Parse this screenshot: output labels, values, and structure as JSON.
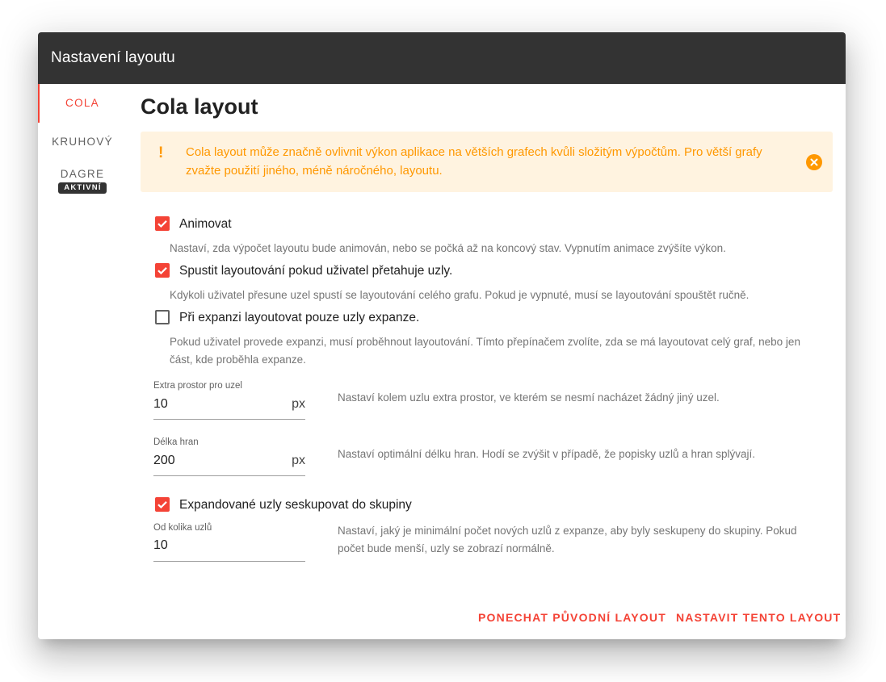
{
  "dialog": {
    "title": "Nastavení layoutu"
  },
  "tabs": [
    {
      "label": "COLA",
      "active": true
    },
    {
      "label": "KRUHOVÝ",
      "active": false
    },
    {
      "label": "DAGRE",
      "active": false,
      "badge": "AKTIVNÍ"
    }
  ],
  "content": {
    "heading": "Cola layout",
    "alert": {
      "icon": "exclamation-icon",
      "message": "Cola layout může značně ovlivnit výkon aplikace na větších grafech kvůli složitým výpočtům. Pro větší grafy zvažte použití jiného, méně náročného, layoutu.",
      "close_icon": "close-circle-icon"
    },
    "options": [
      {
        "label": "Animovat",
        "checked": true,
        "description": "Nastaví, zda výpočet layoutu bude animován, nebo se počká až na koncový stav. Vypnutím animace zvýšíte výkon."
      },
      {
        "label": "Spustit layoutování pokud uživatel přetahuje uzly.",
        "checked": true,
        "description": "Kdykoli uživatel přesune uzel spustí se layoutování celého grafu. Pokud je vypnuté, musí se layoutování spouštět ručně."
      },
      {
        "label": "Při expanzi layoutovat pouze uzly expanze.",
        "checked": false,
        "description": "Pokud uživatel provede expanzi, musí proběhnout layoutování. Tímto přepínačem zvolíte, zda se má layoutovat celý graf, nebo jen část, kde proběhla expanze."
      }
    ],
    "fields": {
      "extra_space": {
        "label": "Extra prostor pro uzel",
        "value": "10",
        "suffix": "px",
        "description": "Nastaví kolem uzlu extra prostor, ve kterém se nesmí nacházet žádný jiný uzel."
      },
      "edge_length": {
        "label": "Délka hran",
        "value": "200",
        "suffix": "px",
        "description": "Nastaví optimální délku hran. Hodí se zvýšit v případě, že popisky uzlů a hran splývají."
      }
    },
    "group": {
      "label": "Expandované uzly seskupovat do skupiny",
      "checked": true,
      "field": {
        "label": "Od kolika uzlů",
        "value": "10",
        "description": "Nastaví, jaký je minimální počet nových uzlů z expanze, aby byly seskupeny do skupiny. Pokud počet bude menší, uzly se zobrazí normálně."
      }
    }
  },
  "actions": {
    "keep_label": "PONECHAT PŮVODNÍ LAYOUT",
    "apply_label": "NASTAVIT TENTO LAYOUT"
  },
  "colors": {
    "accent": "#f44336",
    "header": "#333333",
    "warning": "#ff9800",
    "warning_bg": "#fff3e0"
  }
}
